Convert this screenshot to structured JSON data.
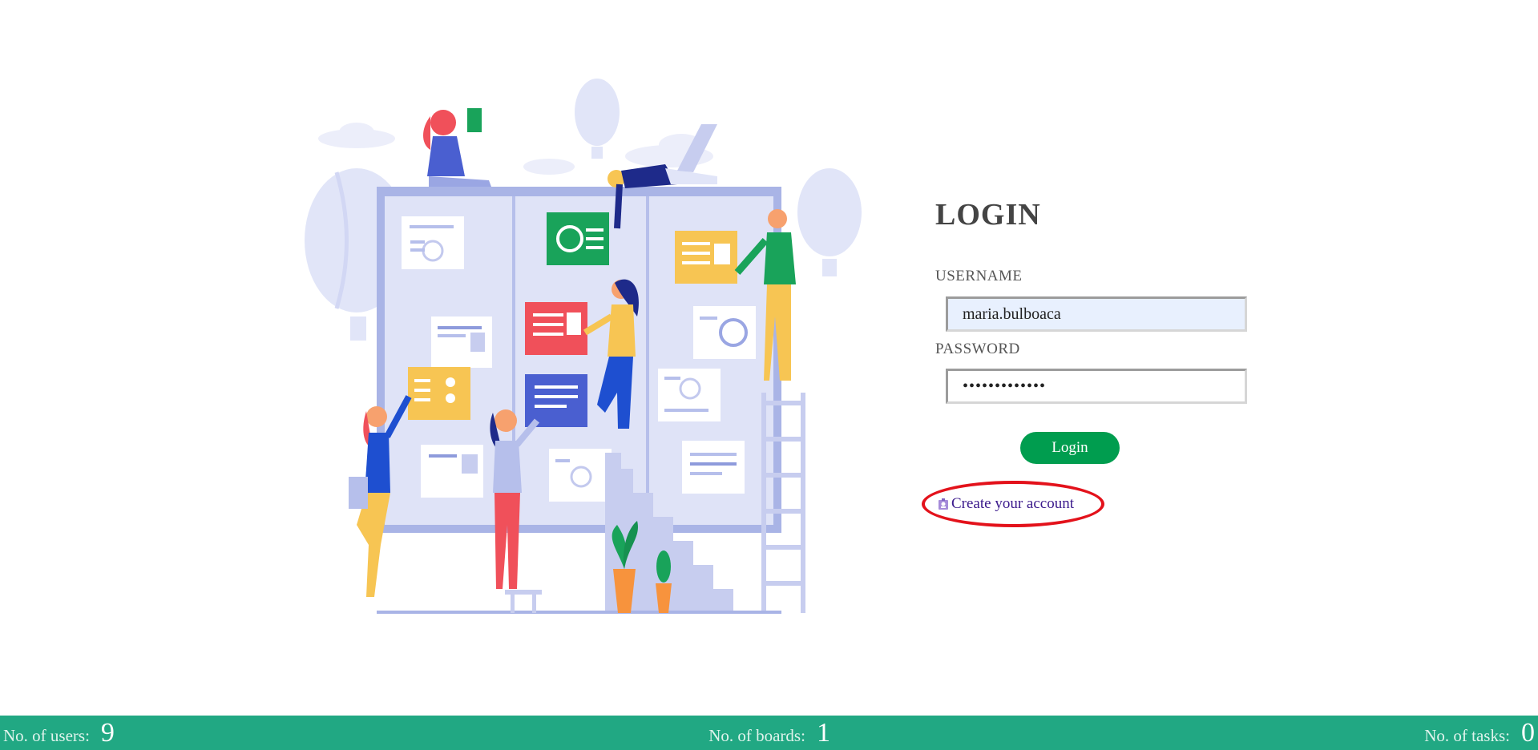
{
  "login": {
    "title": "LOGIN",
    "username_label": "USERNAME",
    "username_value": "maria.bulboaca",
    "password_label": "PASSWORD",
    "password_value": "•••••••••••••",
    "button_label": "Login",
    "create_account_label": "Create your account"
  },
  "colors": {
    "login_button": "#009d4f",
    "footer_bg": "#21a883",
    "highlight": "#e3121b",
    "link": "#3b1a8c"
  },
  "footer": {
    "users_label": "No. of users:",
    "users_count": "9",
    "boards_label": "No. of boards:",
    "boards_count": "1",
    "tasks_label": "No. of tasks:",
    "tasks_count": "0"
  },
  "icons": {
    "illustration": "team-kanban-board-illustration",
    "create_account": "add-user-icon"
  }
}
